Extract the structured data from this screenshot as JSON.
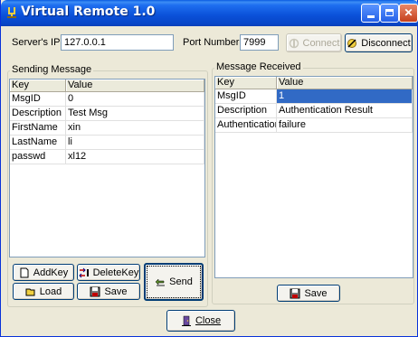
{
  "window": {
    "title": "Virtual Remote 1.0",
    "icon": "tuning-fork-icon"
  },
  "connection": {
    "server_ip_label": "Server's IP",
    "server_ip_value": "127.0.0.1",
    "port_label": "Port Number",
    "port_value": "7999",
    "connect_label": "Connect",
    "disconnect_label": "Disconnect"
  },
  "sending": {
    "group_title": "Sending Message",
    "columns": [
      "Key",
      "Value"
    ],
    "rows": [
      {
        "key": "MsgID",
        "value": "0"
      },
      {
        "key": "Description",
        "value": "Test Msg"
      },
      {
        "key": "FirstName",
        "value": "xin"
      },
      {
        "key": "LastName",
        "value": "li"
      },
      {
        "key": "passwd",
        "value": "xl12"
      }
    ],
    "add_key_label": "AddKey",
    "delete_key_label": "DeleteKey",
    "load_label": "Load",
    "save_label": "Save",
    "send_label": "Send"
  },
  "received": {
    "group_title": "Message Received",
    "columns": [
      "Key",
      "Value"
    ],
    "rows": [
      {
        "key": "MsgID",
        "value": "1"
      },
      {
        "key": "Description",
        "value": "Authentication Result"
      },
      {
        "key": "Authentication",
        "value": "failure"
      }
    ],
    "selected_row": 0,
    "save_label": "Save"
  },
  "footer": {
    "close_label": "Close"
  },
  "colors": {
    "titlebar": "#0a50d8",
    "selection": "#316ac5",
    "window_bg": "#ece9d8"
  }
}
